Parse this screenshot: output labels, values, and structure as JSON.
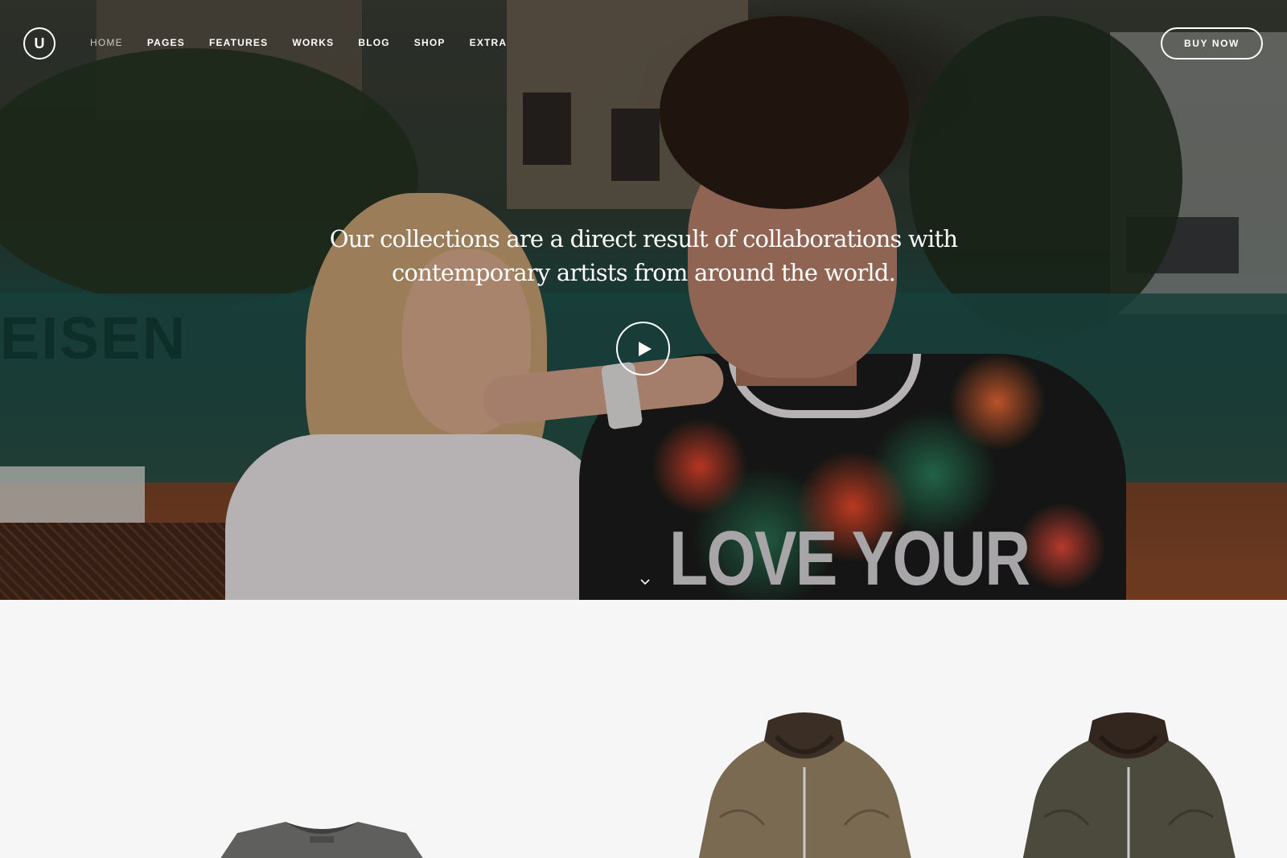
{
  "logo": {
    "letter": "U"
  },
  "nav": {
    "items": [
      {
        "label": "HOME",
        "active": true
      },
      {
        "label": "PAGES"
      },
      {
        "label": "FEATURES"
      },
      {
        "label": "WORKS"
      },
      {
        "label": "BLOG"
      },
      {
        "label": "SHOP"
      },
      {
        "label": "EXTRA"
      }
    ]
  },
  "header": {
    "buy_label": "BUY NOW"
  },
  "hero": {
    "tagline_line1": "Our collections are a direct result of collaborations with",
    "tagline_line2": "contemporary artists from around the world.",
    "shirt_print": "LOVE YOUR",
    "fence_text": "EISEN",
    "play_icon": "play-icon",
    "scroll_icon": "chevron-down-icon"
  },
  "products": {
    "items": [
      {
        "kind": "t-shirt",
        "color": "#5f5f5d"
      },
      {
        "kind": "bomber-jacket",
        "color": "#7a6a52"
      },
      {
        "kind": "bomber-jacket",
        "color": "#4c4a3c"
      }
    ]
  },
  "colors": {
    "accent": "#ffffff",
    "background": "#f6f6f6"
  }
}
